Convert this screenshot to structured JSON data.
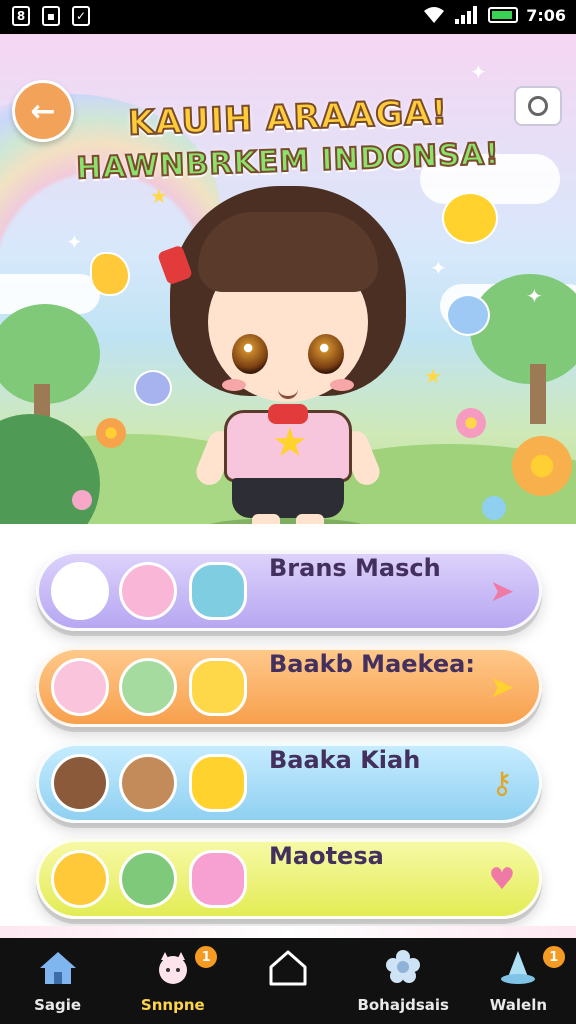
{
  "status_bar": {
    "left_icons": [
      "sim-card-icon",
      "screenshot-icon",
      "clipboard-icon"
    ],
    "time": "7:06"
  },
  "header": {
    "title_line1": "KAUIH ARAAGA!",
    "title_line2": "HAWNBRKEM INDONSA!"
  },
  "menu": {
    "items": [
      {
        "label": "Brans Masch",
        "icon": "chevron-right-icon",
        "color": "#b7a7f2"
      },
      {
        "label": "Baakb Maekea:",
        "icon": "chevron-right-icon",
        "color": "#f7a04d"
      },
      {
        "label": "Baaka Kiah",
        "icon": "key-icon",
        "color": "#8fd0f1"
      },
      {
        "label": "Maotesa",
        "icon": "heart-icon",
        "color": "#e3ec55"
      }
    ]
  },
  "bottom_nav": {
    "items": [
      {
        "label": "Sagie",
        "icon": "home-icon",
        "badge": ""
      },
      {
        "label": "Snnpne",
        "icon": "cat-icon",
        "badge": "1"
      },
      {
        "label": "",
        "icon": "house-outline-icon",
        "badge": ""
      },
      {
        "label": "Bohajdsais",
        "icon": "flower-icon",
        "badge": ""
      },
      {
        "label": "Waleln",
        "icon": "hat-icon",
        "badge": "1"
      }
    ]
  }
}
